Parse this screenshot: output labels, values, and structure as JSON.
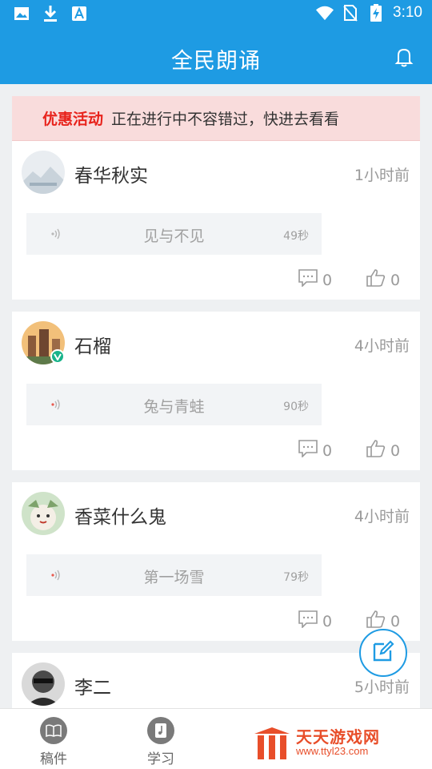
{
  "status_bar": {
    "time": "3:10",
    "left_icons": [
      "image-icon",
      "download-icon",
      "font-app-icon"
    ],
    "right_icons": [
      "wifi-icon",
      "no-sim-icon",
      "battery-charging-icon"
    ]
  },
  "app_bar": {
    "title": "全民朗诵",
    "bell_icon": "bell-icon"
  },
  "promo": {
    "highlight": "优惠活动",
    "text": "正在进行中不容错过，快进去看看"
  },
  "posts": [
    {
      "name": "春华秋实",
      "time": "1小时前",
      "audio_title": "见与不见",
      "duration": "49秒",
      "comments": "0",
      "likes": "0"
    },
    {
      "name": "石榴",
      "time": "4小时前",
      "audio_title": "兔与青蛙",
      "duration": "90秒",
      "comments": "0",
      "likes": "0"
    },
    {
      "name": "香菜什么鬼",
      "time": "4小时前",
      "audio_title": "第一场雪",
      "duration": "79秒",
      "comments": "0",
      "likes": "0"
    },
    {
      "name": "李二",
      "time": "5小时前"
    }
  ],
  "bottom_nav": {
    "tab1": "稿件",
    "tab2": "学习"
  },
  "watermark": {
    "title": "天天游戏网",
    "url": "www.ttyl23.com"
  },
  "colors": {
    "primary": "#1e9be3",
    "promo_bg": "#f9dcdc",
    "promo_highlight": "#e8231c",
    "watermark": "#e84e2a"
  }
}
